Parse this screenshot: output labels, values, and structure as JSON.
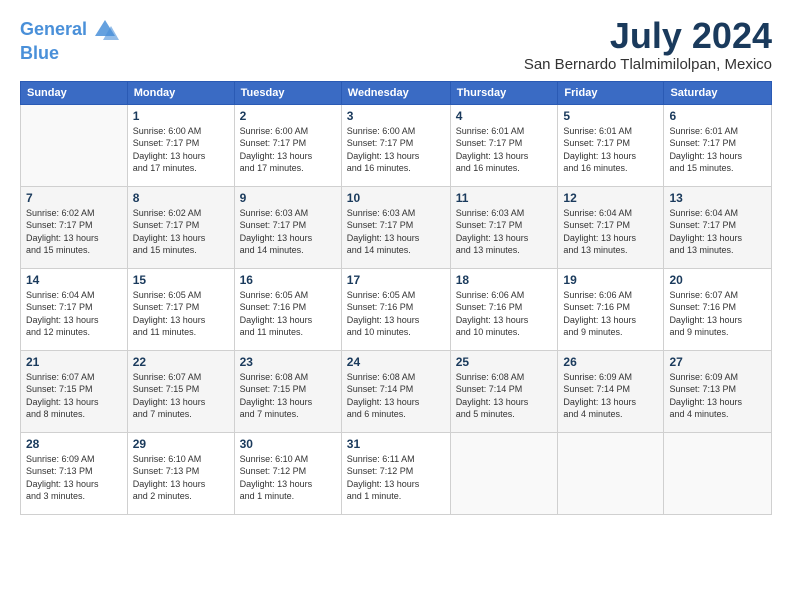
{
  "header": {
    "logo_line1": "General",
    "logo_line2": "Blue",
    "title": "July 2024",
    "subtitle": "San Bernardo Tlalmimilolpan, Mexico"
  },
  "calendar": {
    "days_of_week": [
      "Sunday",
      "Monday",
      "Tuesday",
      "Wednesday",
      "Thursday",
      "Friday",
      "Saturday"
    ],
    "weeks": [
      [
        {
          "day": "",
          "info": ""
        },
        {
          "day": "1",
          "info": "Sunrise: 6:00 AM\nSunset: 7:17 PM\nDaylight: 13 hours\nand 17 minutes."
        },
        {
          "day": "2",
          "info": "Sunrise: 6:00 AM\nSunset: 7:17 PM\nDaylight: 13 hours\nand 17 minutes."
        },
        {
          "day": "3",
          "info": "Sunrise: 6:00 AM\nSunset: 7:17 PM\nDaylight: 13 hours\nand 16 minutes."
        },
        {
          "day": "4",
          "info": "Sunrise: 6:01 AM\nSunset: 7:17 PM\nDaylight: 13 hours\nand 16 minutes."
        },
        {
          "day": "5",
          "info": "Sunrise: 6:01 AM\nSunset: 7:17 PM\nDaylight: 13 hours\nand 16 minutes."
        },
        {
          "day": "6",
          "info": "Sunrise: 6:01 AM\nSunset: 7:17 PM\nDaylight: 13 hours\nand 15 minutes."
        }
      ],
      [
        {
          "day": "7",
          "info": "Sunrise: 6:02 AM\nSunset: 7:17 PM\nDaylight: 13 hours\nand 15 minutes."
        },
        {
          "day": "8",
          "info": "Sunrise: 6:02 AM\nSunset: 7:17 PM\nDaylight: 13 hours\nand 15 minutes."
        },
        {
          "day": "9",
          "info": "Sunrise: 6:03 AM\nSunset: 7:17 PM\nDaylight: 13 hours\nand 14 minutes."
        },
        {
          "day": "10",
          "info": "Sunrise: 6:03 AM\nSunset: 7:17 PM\nDaylight: 13 hours\nand 14 minutes."
        },
        {
          "day": "11",
          "info": "Sunrise: 6:03 AM\nSunset: 7:17 PM\nDaylight: 13 hours\nand 13 minutes."
        },
        {
          "day": "12",
          "info": "Sunrise: 6:04 AM\nSunset: 7:17 PM\nDaylight: 13 hours\nand 13 minutes."
        },
        {
          "day": "13",
          "info": "Sunrise: 6:04 AM\nSunset: 7:17 PM\nDaylight: 13 hours\nand 13 minutes."
        }
      ],
      [
        {
          "day": "14",
          "info": "Sunrise: 6:04 AM\nSunset: 7:17 PM\nDaylight: 13 hours\nand 12 minutes."
        },
        {
          "day": "15",
          "info": "Sunrise: 6:05 AM\nSunset: 7:17 PM\nDaylight: 13 hours\nand 11 minutes."
        },
        {
          "day": "16",
          "info": "Sunrise: 6:05 AM\nSunset: 7:16 PM\nDaylight: 13 hours\nand 11 minutes."
        },
        {
          "day": "17",
          "info": "Sunrise: 6:05 AM\nSunset: 7:16 PM\nDaylight: 13 hours\nand 10 minutes."
        },
        {
          "day": "18",
          "info": "Sunrise: 6:06 AM\nSunset: 7:16 PM\nDaylight: 13 hours\nand 10 minutes."
        },
        {
          "day": "19",
          "info": "Sunrise: 6:06 AM\nSunset: 7:16 PM\nDaylight: 13 hours\nand 9 minutes."
        },
        {
          "day": "20",
          "info": "Sunrise: 6:07 AM\nSunset: 7:16 PM\nDaylight: 13 hours\nand 9 minutes."
        }
      ],
      [
        {
          "day": "21",
          "info": "Sunrise: 6:07 AM\nSunset: 7:15 PM\nDaylight: 13 hours\nand 8 minutes."
        },
        {
          "day": "22",
          "info": "Sunrise: 6:07 AM\nSunset: 7:15 PM\nDaylight: 13 hours\nand 7 minutes."
        },
        {
          "day": "23",
          "info": "Sunrise: 6:08 AM\nSunset: 7:15 PM\nDaylight: 13 hours\nand 7 minutes."
        },
        {
          "day": "24",
          "info": "Sunrise: 6:08 AM\nSunset: 7:14 PM\nDaylight: 13 hours\nand 6 minutes."
        },
        {
          "day": "25",
          "info": "Sunrise: 6:08 AM\nSunset: 7:14 PM\nDaylight: 13 hours\nand 5 minutes."
        },
        {
          "day": "26",
          "info": "Sunrise: 6:09 AM\nSunset: 7:14 PM\nDaylight: 13 hours\nand 4 minutes."
        },
        {
          "day": "27",
          "info": "Sunrise: 6:09 AM\nSunset: 7:13 PM\nDaylight: 13 hours\nand 4 minutes."
        }
      ],
      [
        {
          "day": "28",
          "info": "Sunrise: 6:09 AM\nSunset: 7:13 PM\nDaylight: 13 hours\nand 3 minutes."
        },
        {
          "day": "29",
          "info": "Sunrise: 6:10 AM\nSunset: 7:13 PM\nDaylight: 13 hours\nand 2 minutes."
        },
        {
          "day": "30",
          "info": "Sunrise: 6:10 AM\nSunset: 7:12 PM\nDaylight: 13 hours\nand 1 minute."
        },
        {
          "day": "31",
          "info": "Sunrise: 6:11 AM\nSunset: 7:12 PM\nDaylight: 13 hours\nand 1 minute."
        },
        {
          "day": "",
          "info": ""
        },
        {
          "day": "",
          "info": ""
        },
        {
          "day": "",
          "info": ""
        }
      ]
    ]
  }
}
